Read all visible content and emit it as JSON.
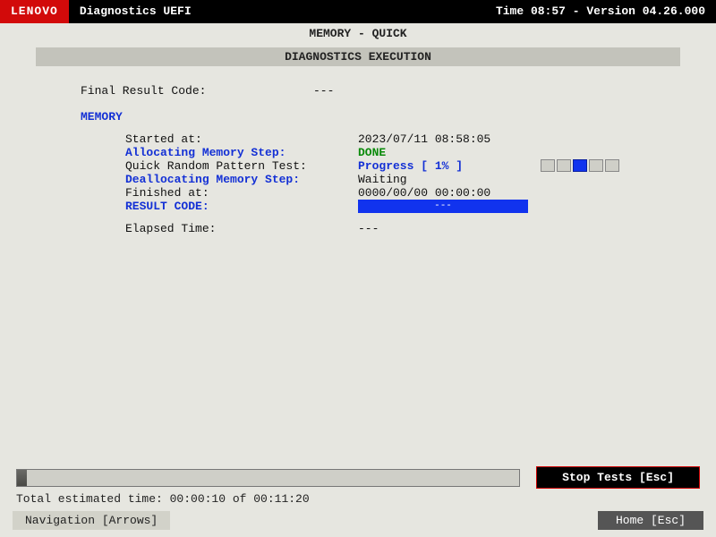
{
  "header": {
    "brand": "LENOVO",
    "app_title": "Diagnostics UEFI",
    "time_label": "Time 08:57 - Version 04.26.000"
  },
  "page_title": "MEMORY - QUICK",
  "section_heading": "DIAGNOSTICS EXECUTION",
  "final_result": {
    "label": "Final Result Code:",
    "value": "---"
  },
  "memory": {
    "section_label": "MEMORY",
    "rows": {
      "started_at": {
        "label": "Started at:",
        "value": "2023/07/11 08:58:05"
      },
      "alloc": {
        "label": "Allocating Memory Step:",
        "value": "DONE"
      },
      "pattern": {
        "label": "Quick Random Pattern Test:",
        "value": "Progress [ 1% ]"
      },
      "dealloc": {
        "label": "Deallocating Memory Step:",
        "value": "Waiting"
      },
      "finished": {
        "label": "Finished at:",
        "value": "0000/00/00 00:00:00"
      },
      "result": {
        "label": "RESULT CODE:",
        "value": "---"
      }
    },
    "elapsed": {
      "label": "Elapsed Time:",
      "value": "---"
    }
  },
  "progress_cells_active_index": 2,
  "overall": {
    "percent": 2,
    "stop_label": "Stop Tests [Esc]",
    "estimated_label": "Total estimated time: 00:00:10 of 00:11:20"
  },
  "footer": {
    "nav_hint": "Navigation [Arrows]",
    "home_label": "Home [Esc]"
  }
}
